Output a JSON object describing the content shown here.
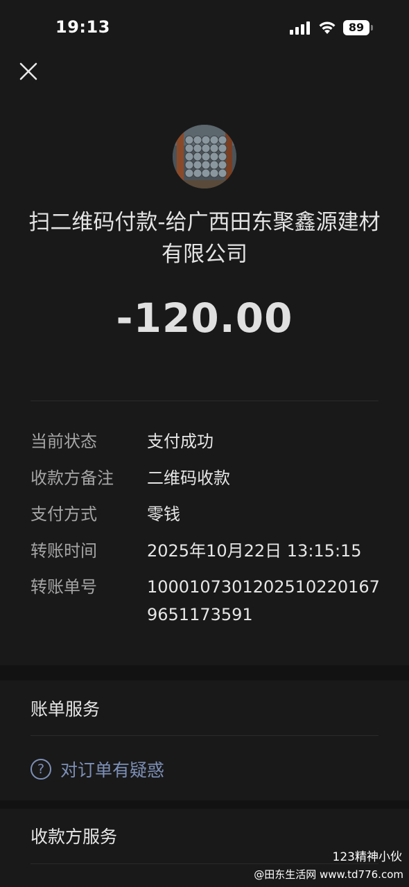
{
  "status_bar": {
    "time": "19:13",
    "battery": "89",
    "icons": [
      "signal-icon",
      "wifi-icon",
      "battery-icon"
    ]
  },
  "header": {
    "close_icon": "close-icon"
  },
  "merchant": {
    "name": "扫二维码付款-给广西田东聚鑫源建材有限公司"
  },
  "amount": "-120.00",
  "details": {
    "status_label": "当前状态",
    "status_value": "支付成功",
    "remark_label": "收款方备注",
    "remark_value": "二维码收款",
    "method_label": "支付方式",
    "method_value": "零钱",
    "time_label": "转账时间",
    "time_value": "2025年10月22日 13:15:15",
    "order_label": "转账单号",
    "order_value": "10001073012025102201679651173591"
  },
  "bill_service": {
    "title": "账单服务",
    "question_label": "对订单有疑惑",
    "question_icon": "question-circle-icon"
  },
  "payee_service": {
    "title": "收款方服务"
  },
  "watermark": {
    "line1": "123精神小伙",
    "line2": "@田东生活网 www.td776.com"
  },
  "colors": {
    "background": "#191919",
    "link": "#7d90b8",
    "label": "#a5a5a5"
  }
}
